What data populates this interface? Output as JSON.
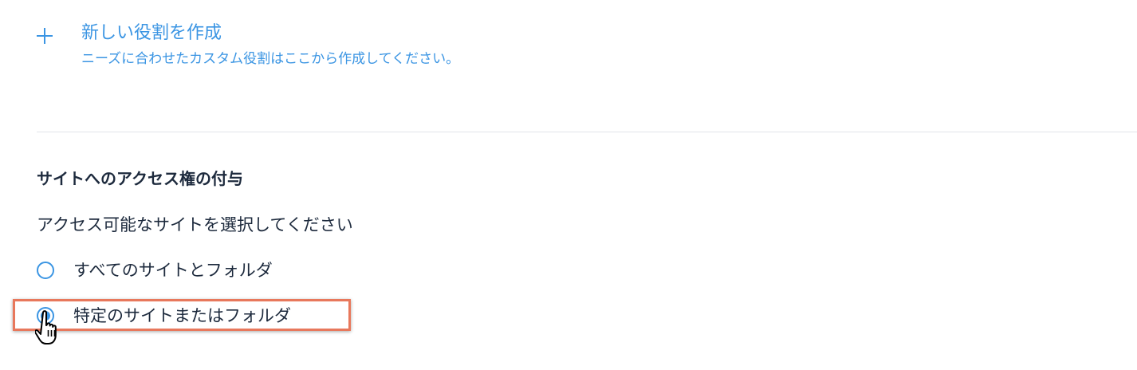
{
  "create_role": {
    "icon": "plus-icon",
    "title": "新しい役割を作成",
    "description": "ニーズに合わせたカスタム役割はここから作成してください。"
  },
  "access": {
    "title": "サイトへのアクセス権の付与",
    "subtitle": "アクセス可能なサイトを選択してください",
    "options": [
      {
        "label": "すべてのサイトとフォルダ",
        "selected": false
      },
      {
        "label": "特定のサイトまたはフォルダ",
        "selected": true
      }
    ]
  },
  "colors": {
    "accent": "#3b95e3",
    "text": "#1d2a3d",
    "highlight": "#e8785c",
    "divider": "#e2e5ea"
  }
}
